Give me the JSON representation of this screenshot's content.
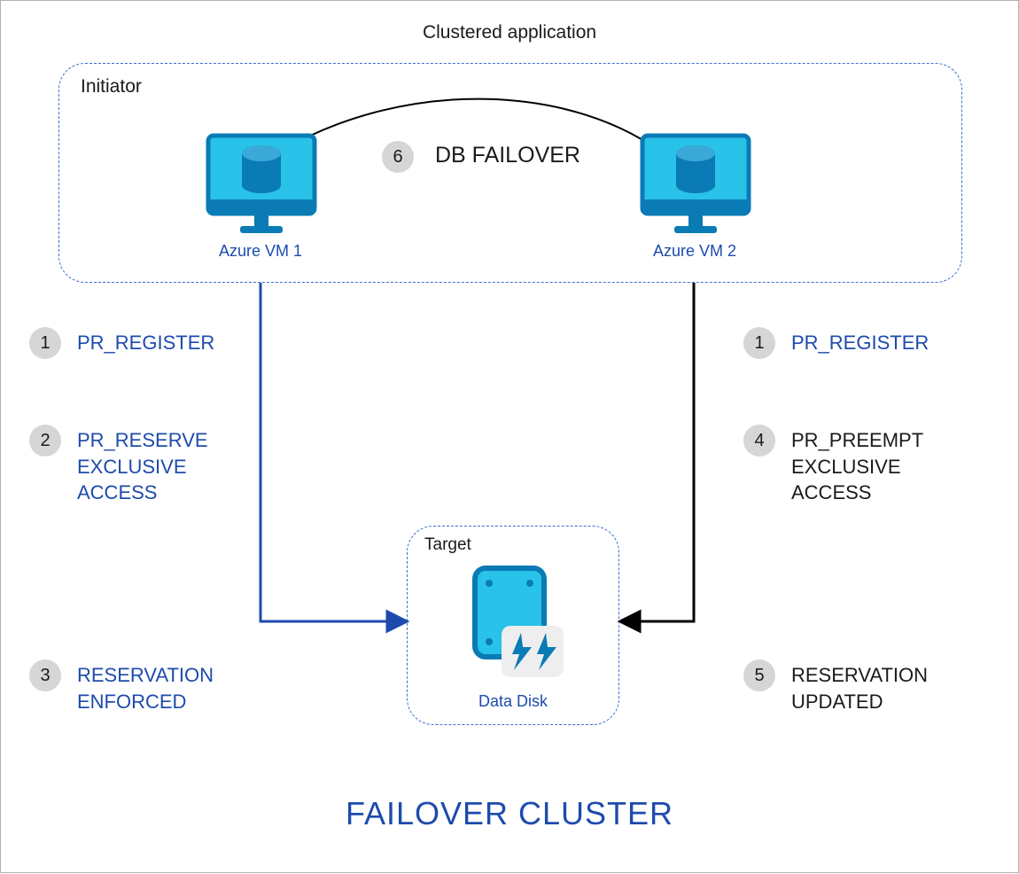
{
  "title": "Clustered application",
  "initiator_label": "Initiator",
  "target_label": "Target",
  "vm1_label": "Azure VM 1",
  "vm2_label": "Azure VM 2",
  "datadisk_label": "Data Disk",
  "footer": "FAILOVER CLUSTER",
  "failover_step_num": "6",
  "failover_step_label": "DB FAILOVER",
  "left_steps": [
    {
      "num": "1",
      "label": "PR_REGISTER",
      "color": "blue"
    },
    {
      "num": "2",
      "label": "PR_RESERVE\nEXCLUSIVE\nACCESS",
      "color": "blue"
    },
    {
      "num": "3",
      "label": "RESERVATION\nENFORCED",
      "color": "blue"
    }
  ],
  "right_steps": [
    {
      "num": "1",
      "label": "PR_REGISTER",
      "color": "blue"
    },
    {
      "num": "4",
      "label": "PR_PREEMPT\nEXCLUSIVE\nACCESS",
      "color": "black"
    },
    {
      "num": "5",
      "label": "RESERVATION\nUPDATED",
      "color": "black"
    }
  ],
  "colors": {
    "azure_blue": "#1d4bad",
    "cyan_fill": "#29c2e8",
    "cyan_stroke": "#0a7bb5"
  }
}
